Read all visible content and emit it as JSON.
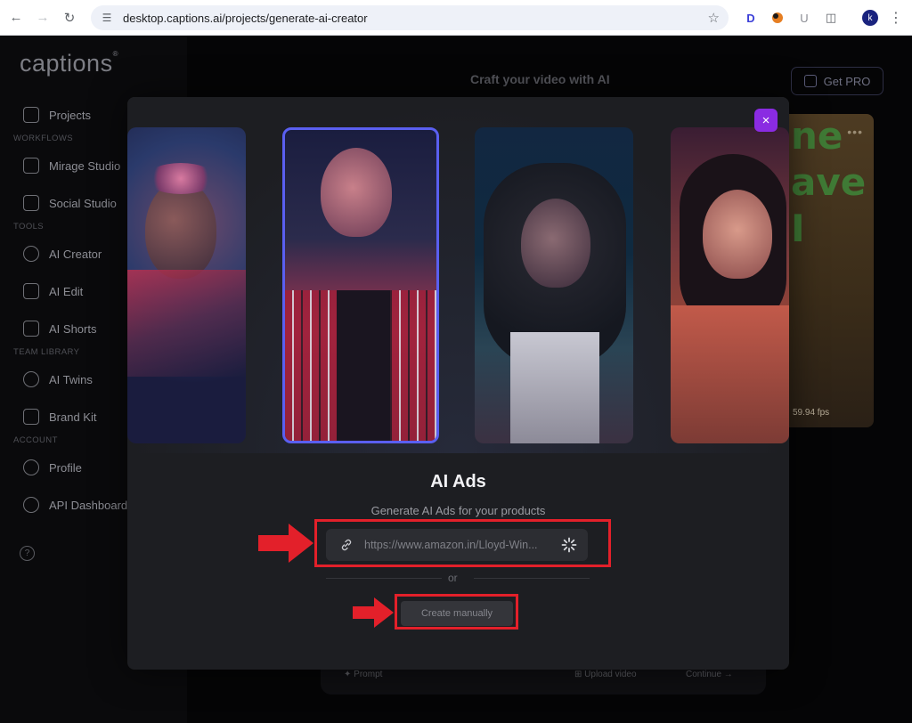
{
  "browser": {
    "url": "desktop.captions.ai/projects/generate-ai-creator",
    "profile_initial": "k",
    "extensions": [
      "D",
      "U"
    ]
  },
  "app": {
    "logo": "captions",
    "sidebar": {
      "items": [
        {
          "label": "Projects",
          "icon": "projects-icon"
        },
        {
          "label": "Mirage Studio",
          "icon": "mirage-icon"
        },
        {
          "label": "Social Studio",
          "icon": "social-icon"
        },
        {
          "label": "AI Creator",
          "icon": "ai-creator-icon"
        },
        {
          "label": "AI Edit",
          "icon": "sparkle-icon"
        },
        {
          "label": "AI Shorts",
          "icon": "play-icon"
        },
        {
          "label": "AI Twins",
          "icon": "smile-icon"
        },
        {
          "label": "Brand Kit",
          "icon": "brand-kit-icon"
        },
        {
          "label": "Profile",
          "icon": "profile-icon"
        },
        {
          "label": "API Dashboard",
          "icon": "api-icon"
        }
      ],
      "sections": [
        "WORKFLOWS",
        "TOOLS",
        "TEAM LIBRARY",
        "ACCOUNT"
      ]
    },
    "header_title": "Craft your video with AI",
    "get_pro": "Get PRO",
    "card_words": [
      "ne",
      "ave",
      "I"
    ],
    "card_fps": "59.94 fps",
    "bottom_bar": {
      "prompt": "Prompt",
      "upload": "Upload video",
      "continue": "Continue →"
    }
  },
  "modal": {
    "title": "AI Ads",
    "subtitle": "Generate AI Ads for your products",
    "url_value": "https://www.amazon.in/Lloyd-Win...",
    "or": "or",
    "create_manually": "Create manually",
    "close": "×"
  },
  "colors": {
    "accent_purple": "#8a2be2",
    "selected_border": "#5a5ff0",
    "annotation_red": "#e3202a"
  }
}
